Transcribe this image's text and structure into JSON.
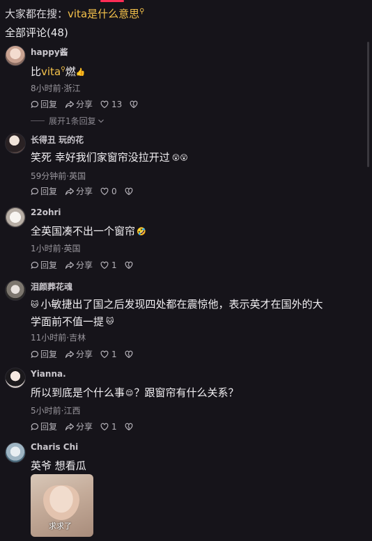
{
  "search_hint": {
    "prefix": "大家都在搜：",
    "keyword": "vita是什么意思"
  },
  "comment_count_label": "全部评论(48)",
  "labels": {
    "reply": "回复",
    "share": "分享"
  },
  "comments": [
    {
      "username": "happy酱",
      "text_before": "比",
      "text_keyword": "vita",
      "text_after": "燃",
      "emoji_after": "👍",
      "meta": "8小时前·浙江",
      "likes": "13",
      "expand_label": "展开1条回复"
    },
    {
      "username": "长得丑 玩的花",
      "text": "笑死 幸好我们家窗帘没拉开过",
      "emoji_after": "😲😲",
      "meta": "59分钟前·英国",
      "likes": "0"
    },
    {
      "username": "22ohri",
      "text": "全英国凑不出一个窗帘",
      "emoji_after": "🤣",
      "meta": "1小时前·英国",
      "likes": "1"
    },
    {
      "username": "泪颜葬花魂",
      "emoji_before": "🐱",
      "text_line1": "小敏捷出了国之后发现四处都在震惊他，表示英才在国外的大",
      "text_line2": "学面前不值一提",
      "emoji_after": "🐱",
      "meta": "11小时前·吉林",
      "likes": "1"
    },
    {
      "username": "Yianna.",
      "text_part1": "所以到底是个什么事",
      "emoji_mid": "😌",
      "text_part2": "？跟窗帘有什么关系？",
      "meta": "5小时前·江西",
      "likes": "1"
    },
    {
      "username": "Charis Chi",
      "text": "英爷 想看瓜",
      "image_caption": "求求了"
    }
  ]
}
